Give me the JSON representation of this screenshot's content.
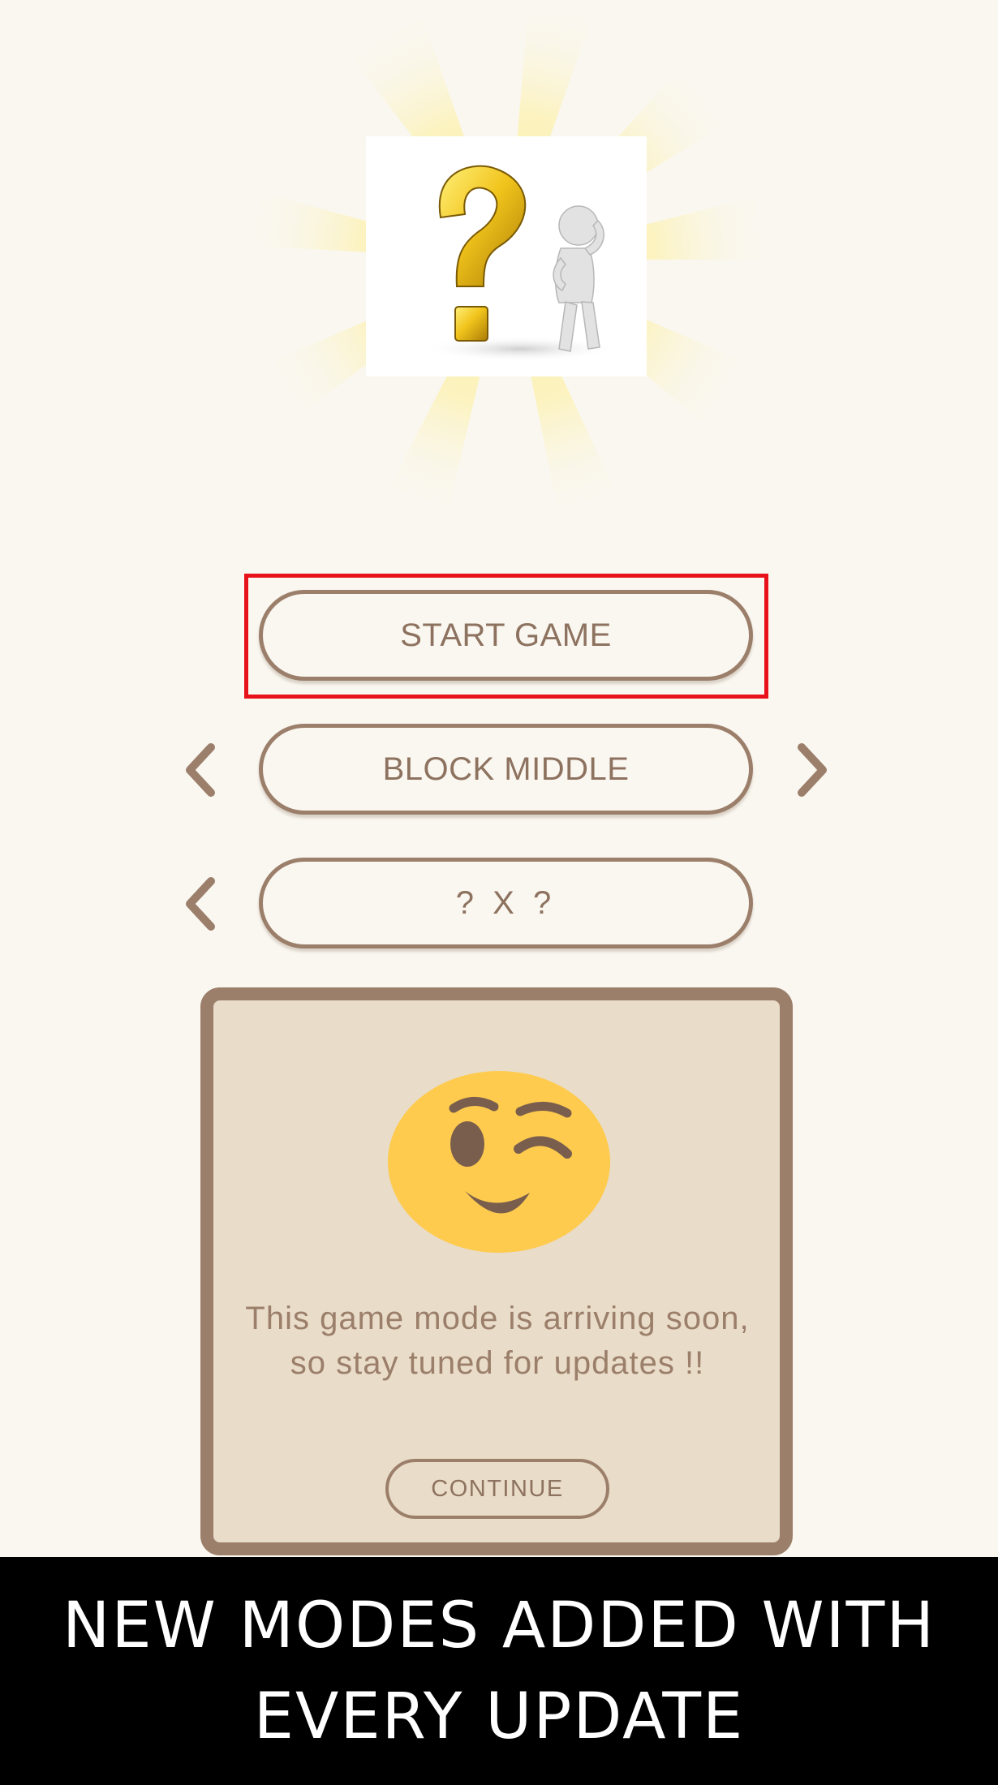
{
  "app": {
    "logo": "question-mark-thinking-figure"
  },
  "menu": {
    "start_label": "START GAME",
    "mode_label": "BLOCK MIDDLE",
    "size_label": "? X ?"
  },
  "dialog": {
    "emoji": "winking-face",
    "message": "This game mode is arriving soon, so stay tuned for updates !!",
    "continue_label": "CONTINUE"
  },
  "caption": {
    "text": "NEW MODES ADDED WITH EVERY UPDATE"
  },
  "colors": {
    "background": "#faf7f0",
    "accent_brown": "#9b7f6b",
    "dialog_fill": "#e9dcc8",
    "highlight": "#e8121b",
    "emoji_yellow": "#fecb4e",
    "banner": "#000000"
  }
}
